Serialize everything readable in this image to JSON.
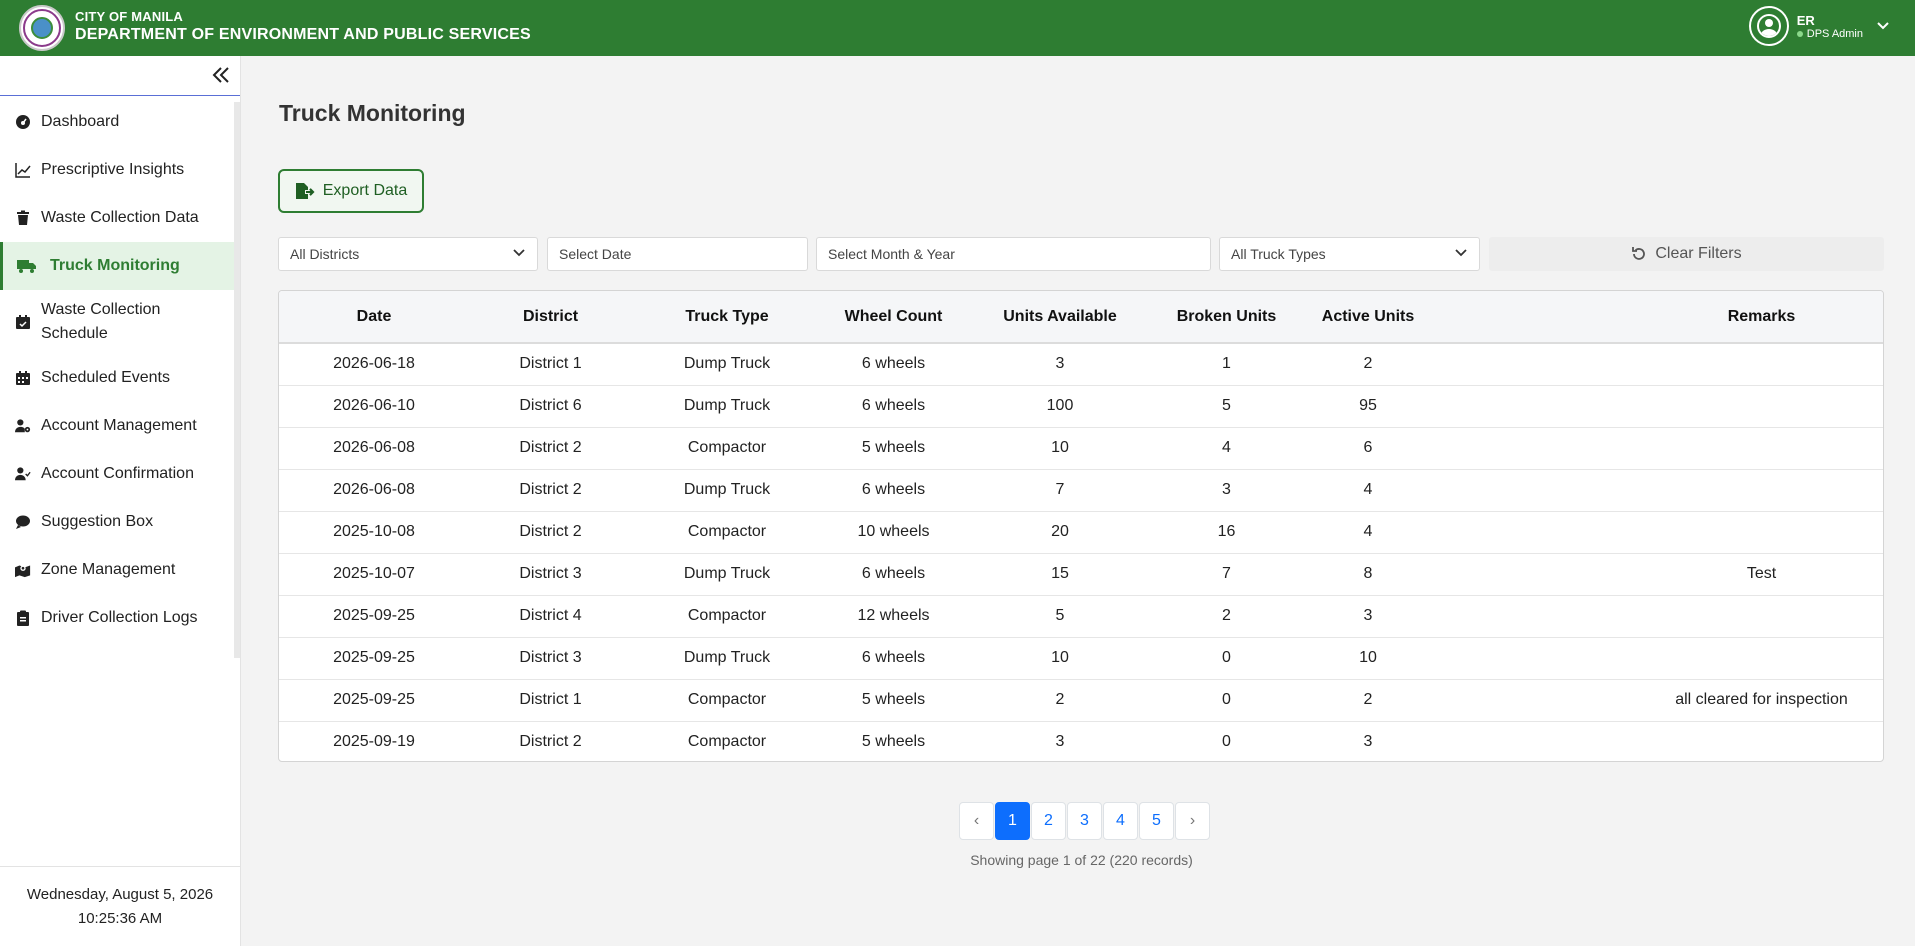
{
  "header": {
    "city": "CITY OF MANILA",
    "department": "DEPARTMENT OF ENVIRONMENT AND PUBLIC SERVICES",
    "user_initials": "ER",
    "user_role": "DPS Admin",
    "brand_color": "#2e7d32"
  },
  "sidebar": {
    "items": [
      {
        "label": "Dashboard",
        "icon": "dashboard-icon"
      },
      {
        "label": "Prescriptive Insights",
        "icon": "line-chart-icon"
      },
      {
        "label": "Waste Collection Data",
        "icon": "trash-icon"
      },
      {
        "label": "Truck Monitoring",
        "icon": "truck-icon",
        "active": true
      },
      {
        "label": "Waste Collection Schedule",
        "icon": "calendar-check-icon"
      },
      {
        "label": "Scheduled Events",
        "icon": "calendar-icon"
      },
      {
        "label": "Account Management",
        "icon": "user-gear-icon"
      },
      {
        "label": "Account Confirmation",
        "icon": "user-check-icon"
      },
      {
        "label": "Suggestion Box",
        "icon": "comment-icon"
      },
      {
        "label": "Zone Management",
        "icon": "map-pin-icon"
      },
      {
        "label": "Driver Collection Logs",
        "icon": "clipboard-icon"
      }
    ],
    "date": "Wednesday, August 5, 2026",
    "time": "10:25:36 AM"
  },
  "main": {
    "title": "Truck Monitoring",
    "export_label": "Export Data",
    "filters": {
      "district": "All Districts",
      "date_placeholder": "Select Date",
      "month_year_placeholder": "Select Month & Year",
      "truck_type": "All Truck Types",
      "clear_label": "Clear Filters"
    },
    "table": {
      "headers": [
        "Date",
        "District",
        "Truck Type",
        "Wheel Count",
        "Units Available",
        "Broken Units",
        "Active Units",
        "Remarks"
      ],
      "rows": [
        [
          "2026-06-18",
          "District 1",
          "Dump Truck",
          "6 wheels",
          "3",
          "1",
          "2",
          ""
        ],
        [
          "2026-06-10",
          "District 6",
          "Dump Truck",
          "6 wheels",
          "100",
          "5",
          "95",
          ""
        ],
        [
          "2026-06-08",
          "District 2",
          "Compactor",
          "5 wheels",
          "10",
          "4",
          "6",
          ""
        ],
        [
          "2026-06-08",
          "District 2",
          "Dump Truck",
          "6 wheels",
          "7",
          "3",
          "4",
          ""
        ],
        [
          "2025-10-08",
          "District 2",
          "Compactor",
          "10 wheels",
          "20",
          "16",
          "4",
          ""
        ],
        [
          "2025-10-07",
          "District 3",
          "Dump Truck",
          "6 wheels",
          "15",
          "7",
          "8",
          "Test"
        ],
        [
          "2025-09-25",
          "District 4",
          "Compactor",
          "12 wheels",
          "5",
          "2",
          "3",
          ""
        ],
        [
          "2025-09-25",
          "District 3",
          "Dump Truck",
          "6 wheels",
          "10",
          "0",
          "10",
          ""
        ],
        [
          "2025-09-25",
          "District 1",
          "Compactor",
          "5 wheels",
          "2",
          "0",
          "2",
          "all cleared for inspection"
        ],
        [
          "2025-09-19",
          "District 2",
          "Compactor",
          "5 wheels",
          "3",
          "0",
          "3",
          ""
        ]
      ]
    },
    "pagination": {
      "prev": "‹",
      "pages": [
        "1",
        "2",
        "3",
        "4",
        "5"
      ],
      "current": "1",
      "next": "›",
      "info": "Showing page 1 of 22 (220 records)"
    }
  }
}
